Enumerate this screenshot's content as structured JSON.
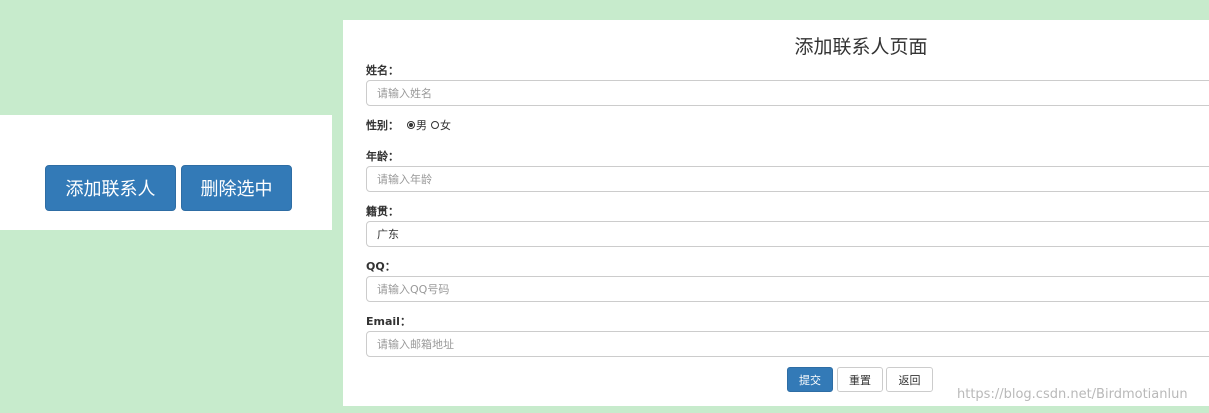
{
  "left_panel": {
    "add_contact_label": "添加联系人",
    "delete_selected_label": "删除选中"
  },
  "form": {
    "title": "添加联系人页面",
    "name_label": "姓名：",
    "name_placeholder": "请输入姓名",
    "gender_label": "性别：",
    "gender_options": [
      "男",
      "女"
    ],
    "gender_selected": "男",
    "age_label": "年龄：",
    "age_placeholder": "请输入年龄",
    "origin_label": "籍贯：",
    "origin_selected": "广东",
    "qq_label": "QQ：",
    "qq_placeholder": "请输入QQ号码",
    "email_label": "Email：",
    "email_placeholder": "请输入邮箱地址",
    "submit_label": "提交",
    "reset_label": "重置",
    "back_label": "返回"
  },
  "watermark": "https://blog.csdn.net/Birdmotianlun",
  "colors": {
    "page_background": "#c7ebcc",
    "primary_button": "#337ab7"
  }
}
